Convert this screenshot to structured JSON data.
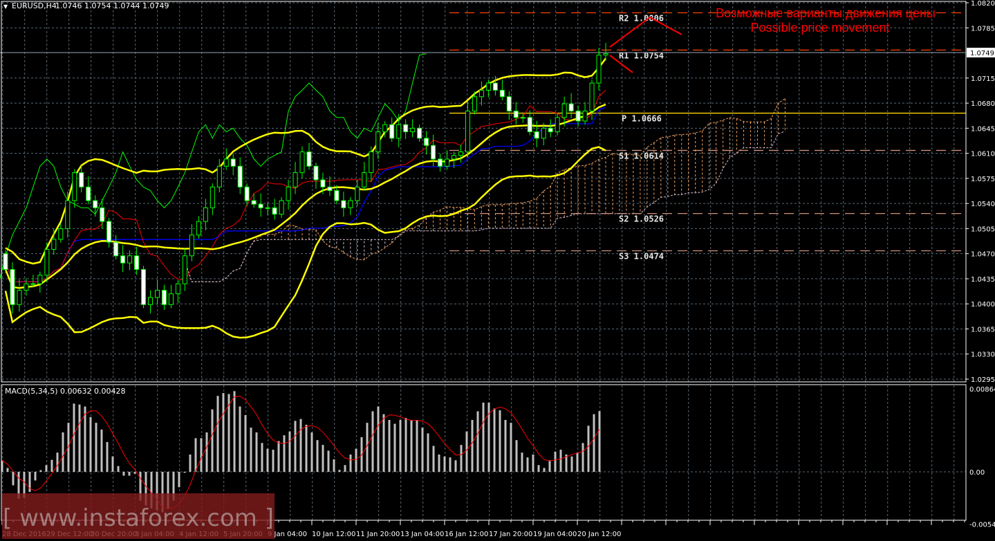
{
  "header": {
    "symbol": "EURUSD,H4",
    "ohlc": "1.0746 1.0754 1.0744 1.0749",
    "menu_icon": "triangle-down-icon"
  },
  "macd_label": "MACD(5,34,5) 0.00632 0.00428",
  "annotation": {
    "line1": "Возможные варианты движения цены",
    "line2": "Possible price movement",
    "color": "#ff0000"
  },
  "current_price": "1.0749",
  "watermark": "[ www.instaforex.com ]",
  "pivots": [
    {
      "label": "R2 1.0806",
      "value": 1.0806,
      "color": "#ff4500"
    },
    {
      "label": "R1 1.0754",
      "value": 1.0754,
      "color": "#ff4500"
    },
    {
      "label": "P 1.0666",
      "value": 1.0666,
      "color": "#ffd700"
    },
    {
      "label": "S1 1.0614",
      "value": 1.0614,
      "color": "#d2907a"
    },
    {
      "label": "S2 1.0526",
      "value": 1.0526,
      "color": "#d2907a"
    },
    {
      "label": "S3 1.0474",
      "value": 1.0474,
      "color": "#d2907a"
    }
  ],
  "colors": {
    "candle": "#00ff00",
    "bollinger": "#ffff00",
    "tenkan": "#ff0000",
    "kijun": "#0000ff",
    "chikou": "#00ff00",
    "span_a": "#f4a460",
    "span_b": "#d8bfd8",
    "macd_hist": "#c0c0c0",
    "macd_signal": "#ff0000",
    "grid": "#5a6a78"
  },
  "chart_data": [
    {
      "type": "candlestick",
      "title": "EURUSD,H4",
      "ylim": [
        1.0295,
        1.082
      ],
      "y_ticks": [
        "1.0820",
        "1.0785",
        "1.0715",
        "1.0680",
        "1.0645",
        "1.0610",
        "1.0575",
        "1.0540",
        "1.0505",
        "1.0470",
        "1.0435",
        "1.0400",
        "1.0365",
        "1.0330",
        "1.0295"
      ],
      "x_labels": [
        "28 Dec 2016",
        "29 Dec 12:00",
        "30 Dec 20:00",
        "3 Jan 04:00",
        "4 Jan 12:00",
        "5 Jan 20:00",
        "9 Jan 04:00",
        "10 Jan 12:00",
        "11 Jan 20:00",
        "13 Jan 04:00",
        "16 Jan 12:00",
        "17 Jan 20:00",
        "19 Jan 04:00",
        "20 Jan 12:00"
      ],
      "first_open": 1.047,
      "closes": [
        1.0448,
        1.0399,
        1.0419,
        1.0428,
        1.0428,
        1.044,
        1.0476,
        1.049,
        1.0505,
        1.0544,
        1.0583,
        1.0563,
        1.0544,
        1.0534,
        1.0515,
        1.0486,
        1.0467,
        1.0457,
        1.0467,
        1.0448,
        1.0399,
        1.0409,
        1.0419,
        1.0399,
        1.0414,
        1.0428,
        1.0467,
        1.0496,
        1.0515,
        1.0534,
        1.0563,
        1.0592,
        1.0602,
        1.0592,
        1.0563,
        1.0544,
        1.0539,
        1.0534,
        1.0534,
        1.0525,
        1.0544,
        1.0563,
        1.0583,
        1.0612,
        1.0592,
        1.0573,
        1.0563,
        1.0558,
        1.0544,
        1.0534,
        1.0544,
        1.0563,
        1.0583,
        1.0612,
        1.064,
        1.065,
        1.0631,
        1.065,
        1.064,
        1.0645,
        1.0631,
        1.0621,
        1.0602,
        1.0592,
        1.0602,
        1.0607,
        1.0612,
        1.0669,
        1.0689,
        1.0698,
        1.0708,
        1.0698,
        1.0689,
        1.0669,
        1.066,
        1.066,
        1.064,
        1.0631,
        1.0645,
        1.064,
        1.066,
        1.0679,
        1.0669,
        1.0655,
        1.0669,
        1.0708,
        1.0747,
        1.0749
      ],
      "indicators": [
        "Bollinger Bands",
        "Ichimoku Kinko Hyo",
        "Pivot Points"
      ]
    },
    {
      "type": "bar",
      "title": "MACD(5,34,5)",
      "ylim": [
        -0.00544,
        0.00864
      ],
      "y_ticks": [
        "0.00864",
        "0.00",
        "-0.00544"
      ],
      "histogram": [
        0.00118,
        0.0004,
        -0.0014,
        -0.0028,
        -0.0027,
        -0.0021,
        -0.0009,
        0.00017,
        0.0007,
        0.00125,
        0.002,
        0.0041,
        0.0051,
        0.0071,
        0.007,
        0.0068,
        0.0057,
        0.0051,
        0.0044,
        0.0031,
        0.0016,
        0.0006,
        -0.0004,
        -0.0004,
        -0.0002,
        -0.003,
        -0.0035,
        -0.0038,
        -0.004,
        -0.0042,
        -0.0038,
        -0.003,
        -0.0016,
        -0.0001,
        0.0018,
        0.0035,
        0.0035,
        0.0041,
        0.0065,
        0.0079,
        0.0082,
        0.0081,
        0.0084,
        0.0068,
        0.0059,
        0.0046,
        0.0041,
        0.003,
        0.0024,
        0.0023,
        0.0032,
        0.0038,
        0.0042,
        0.0053,
        0.0055,
        0.0049,
        0.0041,
        0.0033,
        0.0028,
        0.0022,
        0.0013,
        0.0002,
        0.0007,
        0.0018,
        0.0024,
        0.0036,
        0.0051,
        0.0063,
        0.0068,
        0.006,
        0.0054,
        0.005,
        0.0054,
        0.0056,
        0.0054,
        0.0054,
        0.0046,
        0.004,
        0.0027,
        0.0018,
        0.0016,
        0.0015,
        0.0012,
        0.0028,
        0.0042,
        0.0054,
        0.0063,
        0.0072,
        0.0072,
        0.0066,
        0.0064,
        0.0054,
        0.0051,
        0.0033,
        0.002,
        0.0015,
        0.0018,
        0.0007,
        0.0004,
        0.0012,
        0.0021,
        0.0023,
        0.0018,
        0.0016,
        0.002,
        0.003,
        0.0048,
        0.006,
        0.00632
      ],
      "signal_last": 0.00428
    }
  ]
}
